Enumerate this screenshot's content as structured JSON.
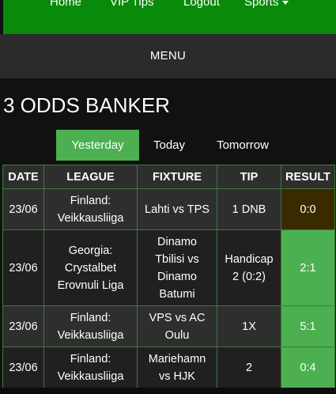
{
  "nav": {
    "home": "Home",
    "vip_tips": "VIP Tips",
    "logout": "Logout",
    "sports": "Sports"
  },
  "menu": {
    "label": "MENU"
  },
  "page": {
    "title": "3 ODDS BANKER"
  },
  "tabs": [
    {
      "label": "Yesterday",
      "active": true
    },
    {
      "label": "Today",
      "active": false
    },
    {
      "label": "Tomorrow",
      "active": false
    }
  ],
  "table": {
    "headers": [
      "DATE",
      "LEAGUE",
      "FIXTURE",
      "TIP",
      "RESULT"
    ],
    "rows": [
      {
        "date": "23/06",
        "league_line1": "Finland:",
        "league_line2": "Veikkausliiga",
        "league_line3": "",
        "fixture_line1": "Lahti vs TPS",
        "fixture_line2": "",
        "fixture_line3": "",
        "fixture_line4": "",
        "tip_line1": "1 DNB",
        "tip_line2": "",
        "result": "0:0",
        "status": "pending"
      },
      {
        "date": "23/06",
        "league_line1": "Georgia:",
        "league_line2": "Crystalbet",
        "league_line3": "Erovnuli Liga",
        "fixture_line1": "Dinamo",
        "fixture_line2": "Tbilisi vs",
        "fixture_line3": "Dinamo",
        "fixture_line4": "Batumi",
        "tip_line1": "Handicap",
        "tip_line2": "2 (0:2)",
        "result": "2:1",
        "status": "win"
      },
      {
        "date": "23/06",
        "league_line1": "Finland:",
        "league_line2": "Veikkausliiga",
        "league_line3": "",
        "fixture_line1": "VPS vs AC",
        "fixture_line2": "Oulu",
        "fixture_line3": "",
        "fixture_line4": "",
        "tip_line1": "1X",
        "tip_line2": "",
        "result": "5:1",
        "status": "win"
      },
      {
        "date": "23/06",
        "league_line1": "Finland:",
        "league_line2": "Veikkausliiga",
        "league_line3": "",
        "fixture_line1": "Mariehamn",
        "fixture_line2": "vs HJK",
        "fixture_line3": "",
        "fixture_line4": "",
        "tip_line1": "2",
        "tip_line2": "",
        "result": "0:4",
        "status": "win"
      }
    ]
  },
  "colors": {
    "nav_green": "#0a8a0a",
    "tab_active": "#4caf50",
    "result_win": "#4caf50",
    "result_pending": "#3a2a00",
    "table_border": "#3d7a3d"
  }
}
